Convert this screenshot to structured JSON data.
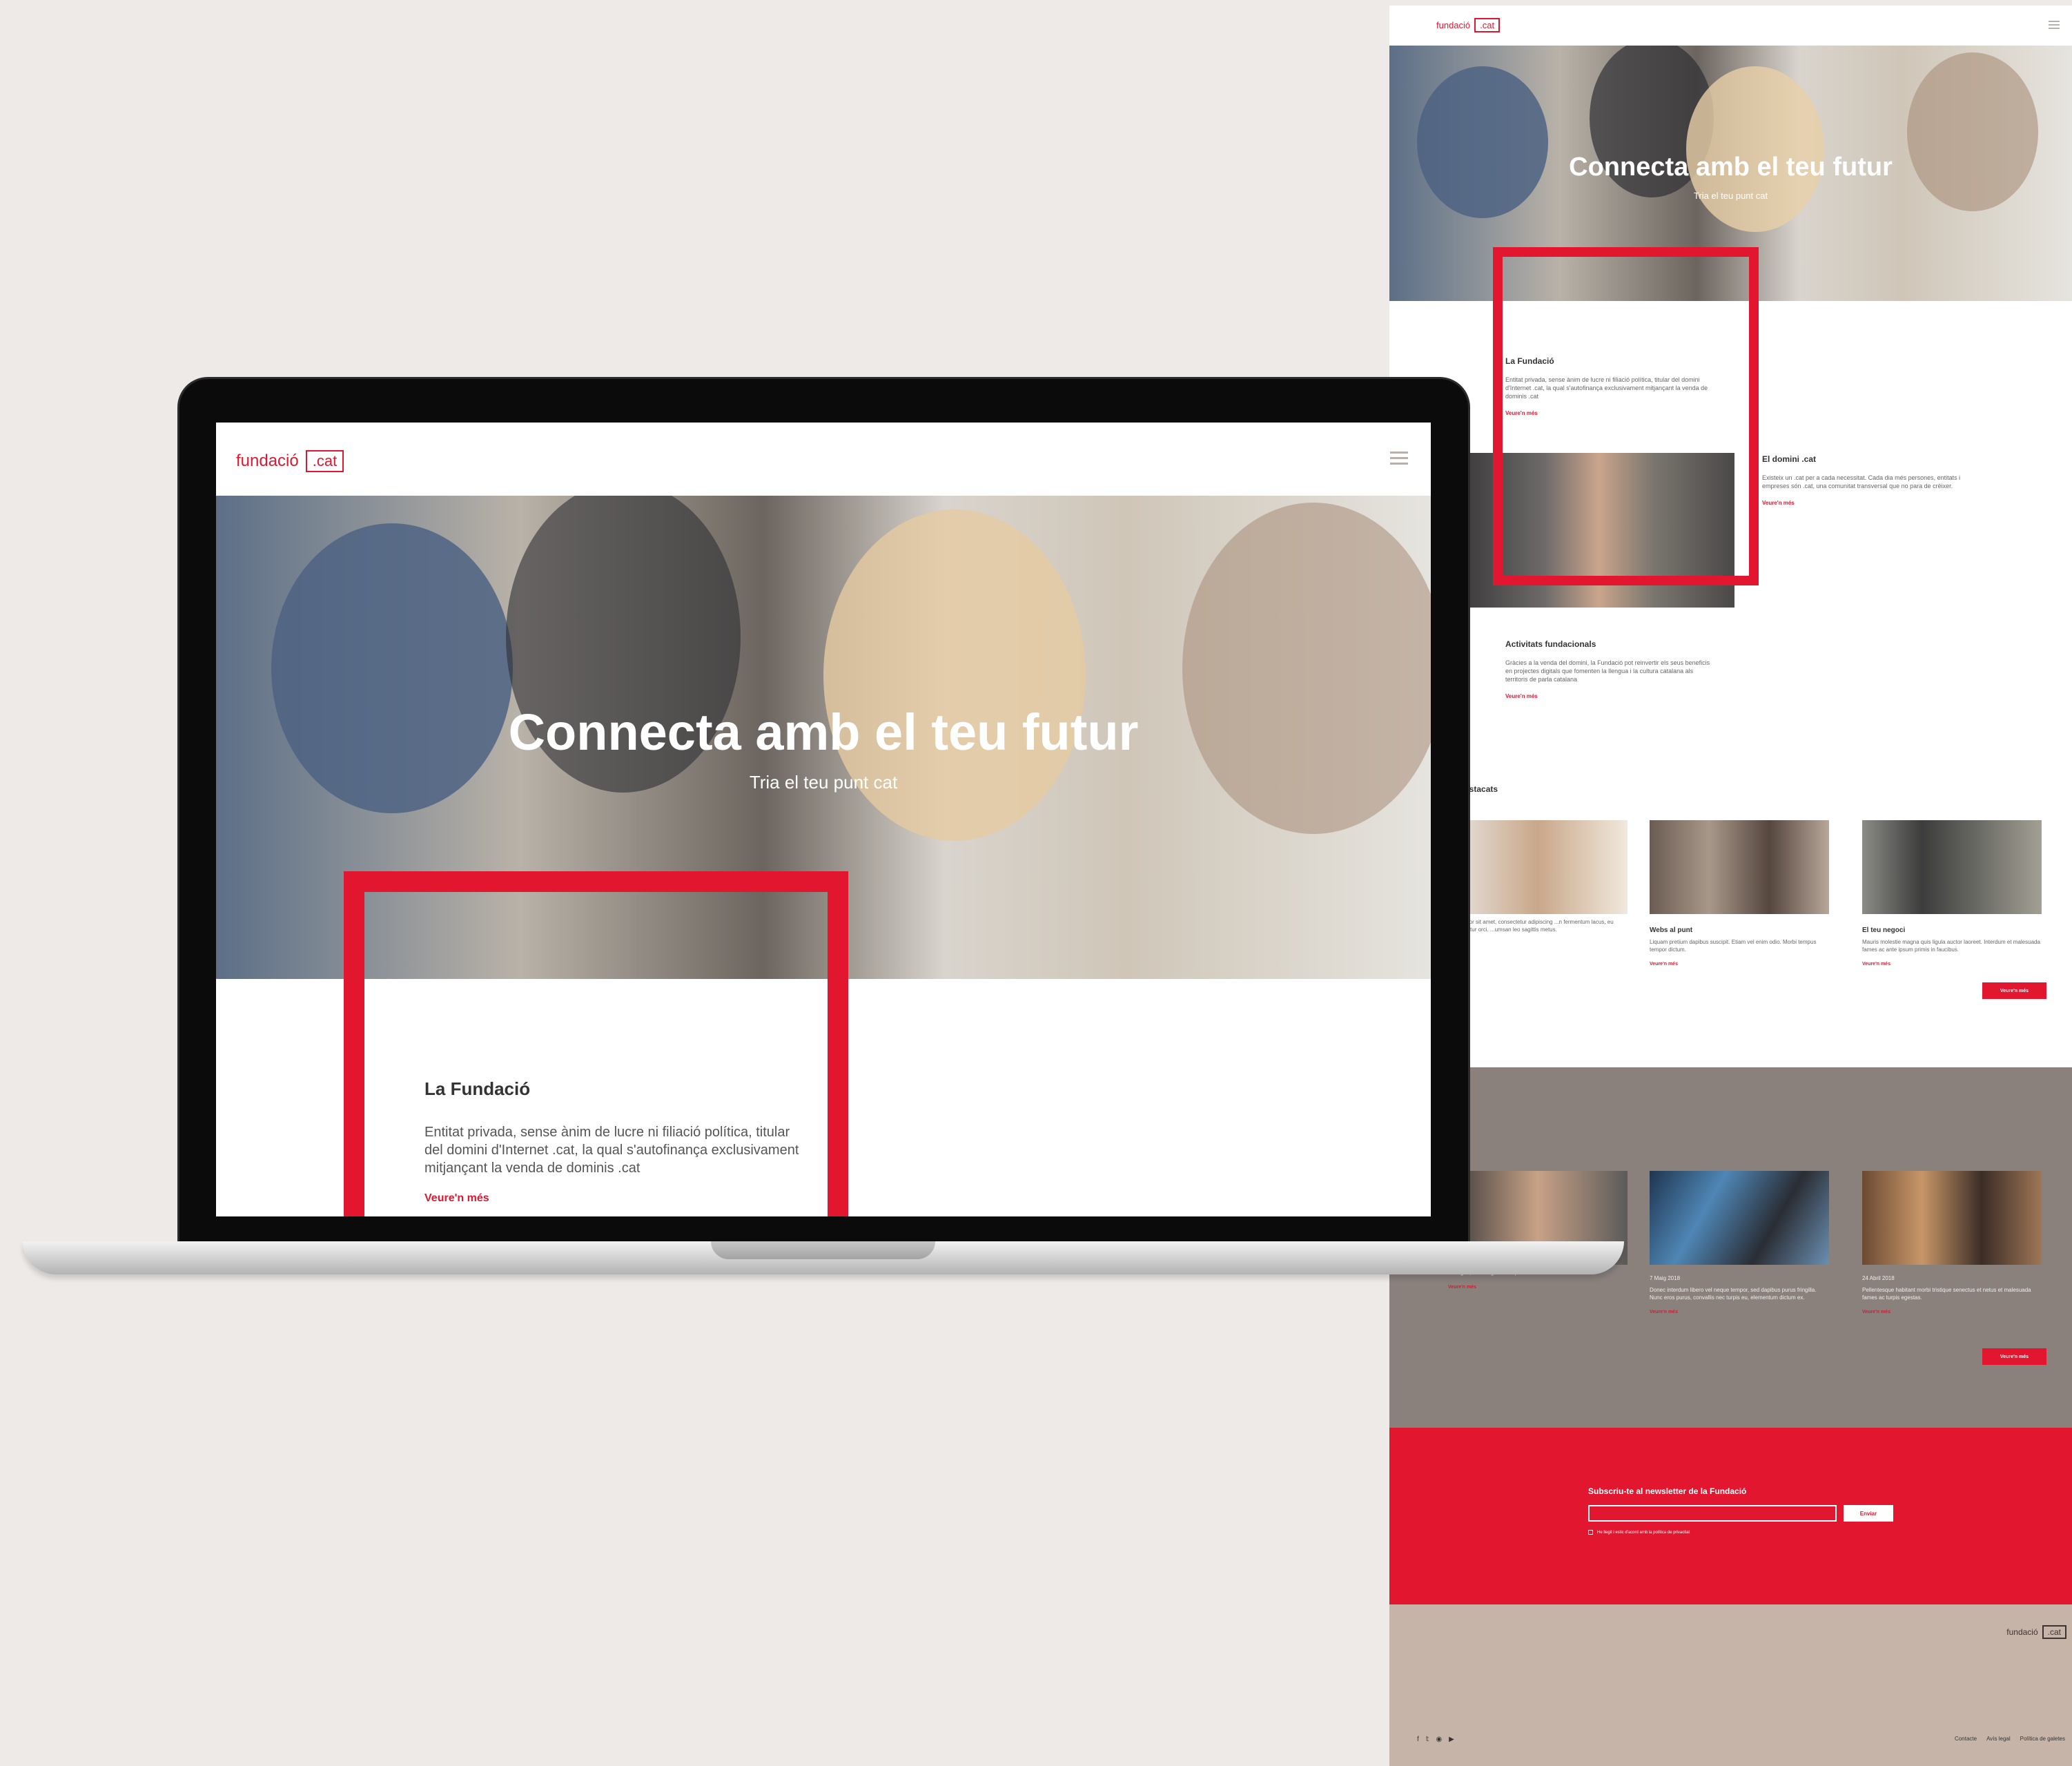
{
  "brand": {
    "name": "fundació",
    "tld": ".cat",
    "accent": "#e2162e"
  },
  "hero": {
    "title": "Connecta amb el teu futur",
    "subtitle": "Tria el teu punt cat"
  },
  "laptop": {
    "about": {
      "title": "La Fundació",
      "text": "Entitat privada, sense ànim de lucre ni filiació política, titular del domini d'Internet .cat, la qual s'autofinança exclusivament mitjançant la venda de dominis .cat",
      "link": "Veure'n més"
    }
  },
  "page": {
    "about": {
      "title": "La Fundació",
      "text": "Entitat privada, sense ànim de lucre ni filiació política, titular del domini d'Internet .cat, la qual s'autofinança exclusivament mitjançant la venda de dominis .cat",
      "link": "Veure'n més"
    },
    "domain": {
      "title": "El domini .cat",
      "text": "Existeix un .cat per a cada necessitat. Cada dia més persones, entitats i empreses són .cat, una comunitat transversal que no para de créixer.",
      "link": "Veure'n més"
    },
    "activities": {
      "title": "Activitats fundacionals",
      "text": "Gràcies a la venda del domini, la Fundació pot reinvertir els seus beneficis en projectes digitals que fomenten la llengua i la cultura catalana als territoris de parla catalana",
      "link": "Veure'n més"
    },
    "featured": {
      "title": "es destacats",
      "items": [
        {
          "title": "",
          "text": "...um dolor sit amet, consectetur adipiscing ...n fermentum lacus, eu consectetur orci. ...umsan leo sagittis metus.",
          "link": ""
        },
        {
          "title": "Webs al punt",
          "text": "Liquam pretium dapibus suscipit. Etiam vel enim odio. Morbi tempus tempor dictum.",
          "link": "Veure'n més"
        },
        {
          "title": "El teu negoci",
          "text": "Mauris molestie magna quis ligula auctor laoreet. Interdum et malesuada fames ac ante ipsum primis in faucibus.",
          "link": "Veure'n més"
        }
      ],
      "button": "Veure'n més"
    },
    "news": {
      "title": "s",
      "items": [
        {
          "date": "",
          "text": "...magna, sed fringilla urna porta ac.",
          "link": "Veure'n més"
        },
        {
          "date": "7 Maig 2018",
          "text": "Donec interdum libero vel neque tempor, sed dapibus purus fringilla. Nunc eros purus, convallis nec turpis eu, elementum dictum ex.",
          "link": "Veure'n més"
        },
        {
          "date": "24 Abril 2018",
          "text": "Pellentesque habitant morbi tristique senectus et netus et malesuada fames ac turpis egestas.",
          "link": "Veure'n més"
        }
      ],
      "button": "Veure'n més"
    },
    "newsletter": {
      "title": "Subscriu-te al newsletter de la Fundació",
      "button": "Enviar",
      "checkbox": "He llegit i estic d'acord amb la política de privacitat"
    },
    "footer": {
      "social": [
        "f",
        "𝕥",
        "◉",
        "▶"
      ],
      "links": [
        "Contacte",
        "Avís legal",
        "Política de galetes"
      ]
    }
  }
}
